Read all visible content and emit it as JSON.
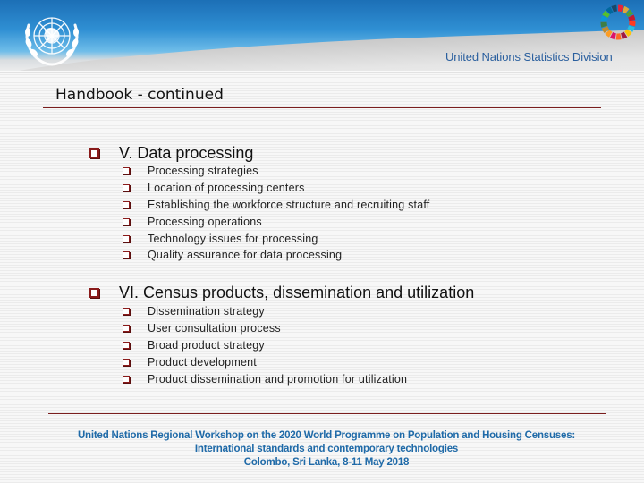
{
  "header": {
    "org_title": "United Nations Statistics Division",
    "logos": [
      "un-emblem-icon",
      "sdg-wheel-icon"
    ]
  },
  "page_title": "Handbook - continued",
  "sections": [
    {
      "title": "V. Data processing",
      "items": [
        "Processing strategies",
        "Location of processing centers",
        "Establishing the workforce structure and recruiting staff",
        "Processing operations",
        "Technology issues for processing",
        "Quality assurance for data processing"
      ]
    },
    {
      "title": "VI. Census products, dissemination and utilization",
      "items": [
        "Dissemination strategy",
        "User consultation process",
        "Broad product strategy",
        "Product development",
        "Product dissemination and promotion for utilization"
      ]
    }
  ],
  "footer": {
    "line1": "United Nations Regional Workshop on the 2020 World Programme on Population and Housing Censuses:",
    "line2": "International standards and contemporary technologies",
    "line3": "Colombo, Sri Lanka, 8-11 May 2018"
  },
  "colors": {
    "accent": "#8a1b1b",
    "footer_text": "#1f6aa8",
    "header_blue": "#2f8fd3"
  }
}
